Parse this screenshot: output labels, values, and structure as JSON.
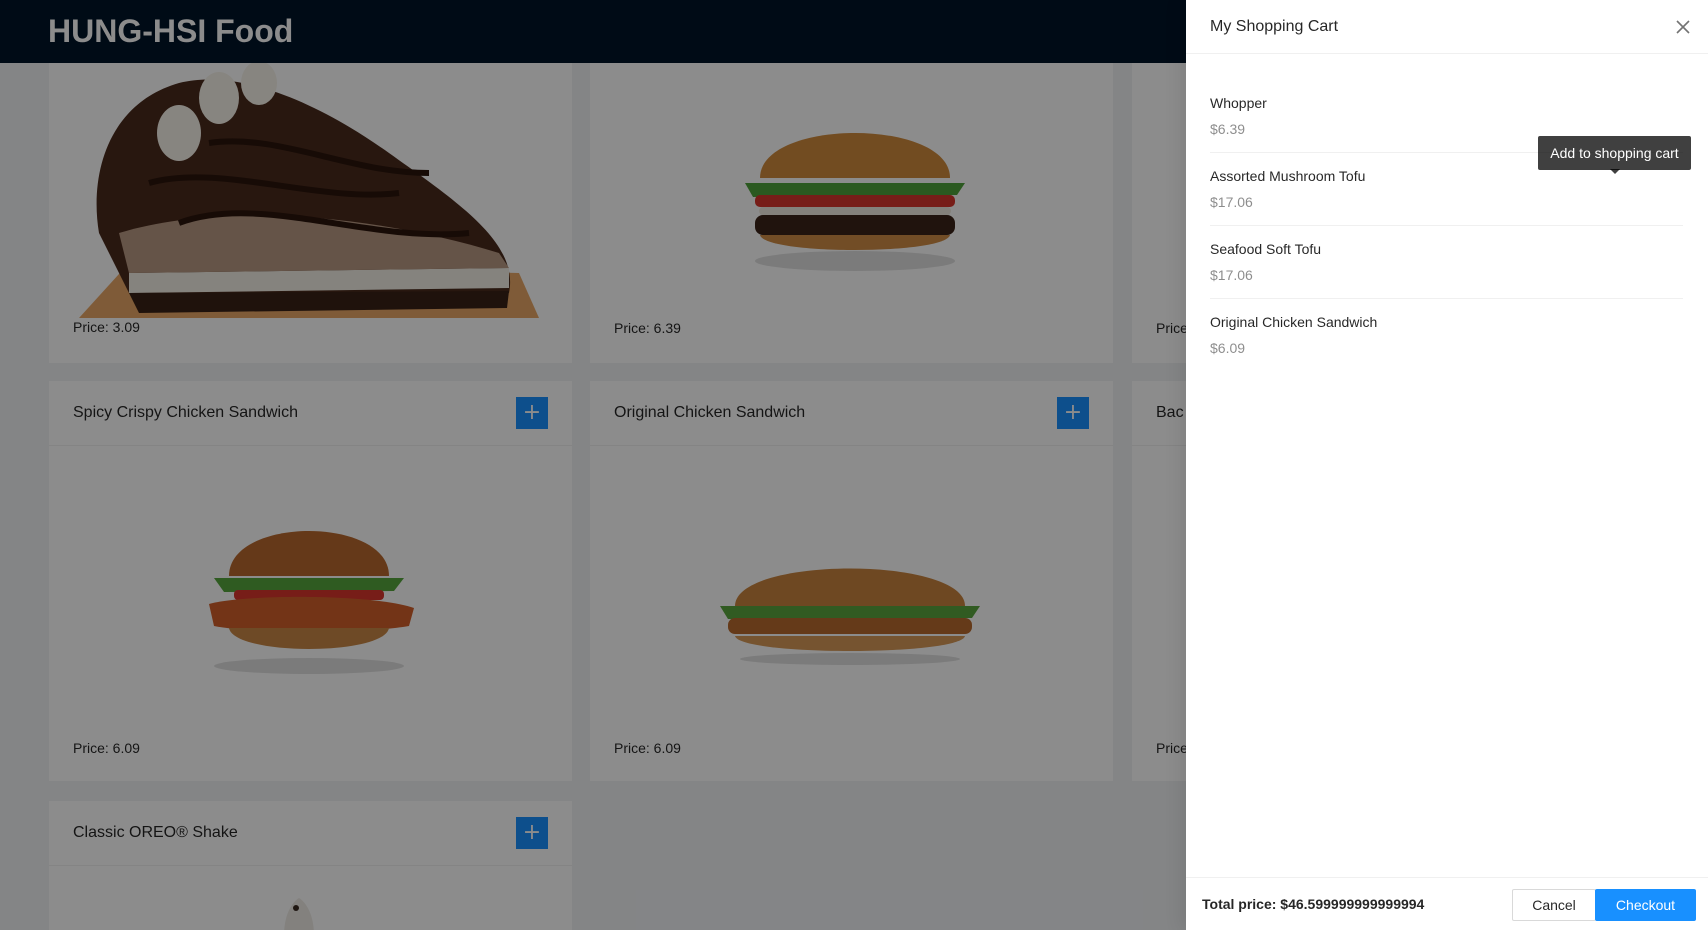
{
  "header": {
    "title": "HUNG-HSI Food"
  },
  "menu": {
    "cards": [
      {
        "title": "",
        "price_text": "Price: 3.09",
        "image": "chocolate-pie-image"
      },
      {
        "title": "",
        "price_text": "Price: 6.39",
        "image": "whopper-burger-image"
      },
      {
        "title": "",
        "price_text": "Price",
        "image": ""
      },
      {
        "title": "Spicy Crispy Chicken Sandwich",
        "price_text": "Price: 6.09",
        "image": "spicy-chicken-sandwich-image",
        "add_label": "+"
      },
      {
        "title": "Original Chicken Sandwich",
        "price_text": "Price: 6.09",
        "image": "original-chicken-sandwich-image",
        "add_label": "+"
      },
      {
        "title": "Bac",
        "price_text": "Price",
        "image": ""
      },
      {
        "title": "Classic OREO® Shake",
        "price_text": "",
        "image": "oreo-shake-image",
        "add_label": "+"
      }
    ]
  },
  "cart": {
    "title": "My Shopping Cart",
    "close_icon": "close-icon",
    "items": [
      {
        "name": "Whopper",
        "price": "$6.39"
      },
      {
        "name": "Assorted Mushroom Tofu",
        "price": "$17.06"
      },
      {
        "name": "Seafood Soft Tofu",
        "price": "$17.06"
      },
      {
        "name": "Original Chicken Sandwich",
        "price": "$6.09"
      }
    ],
    "tooltip": "Add to shopping cart",
    "total_text": "Total price: $46.599999999999994",
    "cancel_label": "Cancel",
    "checkout_label": "Checkout"
  },
  "colors": {
    "header_bg": "#001529",
    "primary": "#1890ff",
    "mask": "rgba(0,0,0,0.45)"
  }
}
